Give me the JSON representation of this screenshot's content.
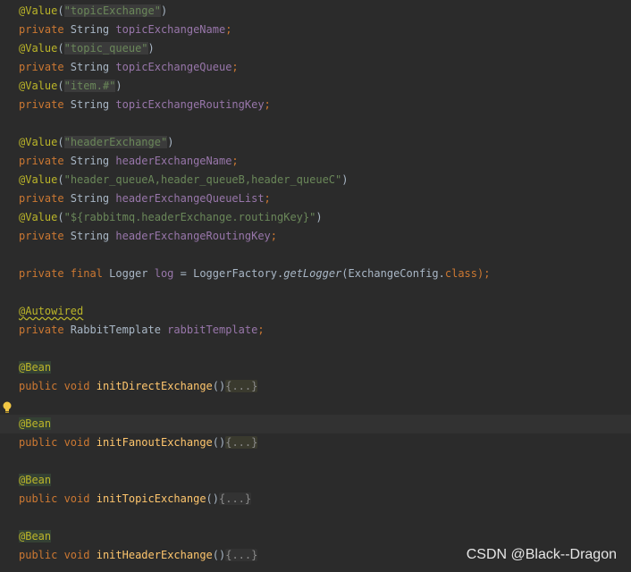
{
  "editor": {
    "lines": {
      "l1": {
        "ann": "@Value",
        "p1": "(",
        "str": "\"topicExchange\"",
        "p2": ")"
      },
      "l2": {
        "kw": "private",
        "type": " String ",
        "field": "topicExchangeName",
        "end": ";"
      },
      "l3": {
        "ann": "@Value",
        "p1": "(",
        "str": "\"topic_queue\"",
        "p2": ")"
      },
      "l4": {
        "kw": "private",
        "type": " String ",
        "field": "topicExchangeQueue",
        "end": ";"
      },
      "l5": {
        "ann": "@Value",
        "p1": "(",
        "str": "\"item.#\"",
        "p2": ")"
      },
      "l6": {
        "kw": "private",
        "type": " String ",
        "field": "topicExchangeRoutingKey",
        "end": ";"
      },
      "l7": {
        "ann": "@Value",
        "p1": "(",
        "str": "\"headerExchange\"",
        "p2": ")"
      },
      "l8": {
        "kw": "private",
        "type": " String ",
        "field": "headerExchangeName",
        "end": ";"
      },
      "l9": {
        "ann": "@Value",
        "p1": "(",
        "str": "\"header_queueA,header_queueB,header_queueC\"",
        "p2": ")"
      },
      "l10": {
        "kw": "private",
        "type": " String ",
        "field": "headerExchangeQueueList",
        "end": ";"
      },
      "l11": {
        "ann": "@Value",
        "p1": "(",
        "str": "\"${rabbitmq.headerExchange.routingKey}\"",
        "p2": ")"
      },
      "l12": {
        "kw": "private",
        "type": " String ",
        "field": "headerExchangeRoutingKey",
        "end": ";"
      },
      "l13": {
        "kw1": "private",
        "kw2": " final",
        "type": " Logger ",
        "field": "log",
        "eq": " = LoggerFactory.",
        "method": "getLogger",
        "arg": "(ExchangeConfig.",
        "cls": "class",
        "end": ");"
      },
      "l14": {
        "ann": "@Autowired"
      },
      "l15": {
        "kw": "private",
        "type": " RabbitTemplate ",
        "field": "rabbitTemplate",
        "end": ";"
      },
      "l16": {
        "ann": "@Bean"
      },
      "l17": {
        "kw1": "public",
        "kw2": " void ",
        "fn": "initDirectExchange",
        "paren": "()",
        "fold": "{...}"
      },
      "l18": {
        "ann": "@Bean"
      },
      "l19": {
        "kw1": "public",
        "kw2": " void ",
        "fn": "initFanoutExchange",
        "paren": "()",
        "fold": "{...}"
      },
      "l20": {
        "ann": "@Bean"
      },
      "l21": {
        "kw1": "public",
        "kw2": " void ",
        "fn": "initTopicExchange",
        "paren": "()",
        "fold": "{...}"
      },
      "l22": {
        "ann": "@Bean"
      },
      "l23": {
        "kw1": "public",
        "kw2": " void ",
        "fn": "initHeaderExchange",
        "paren": "()",
        "fold": "{...}"
      }
    },
    "gutter_icon": "lightbulb-icon",
    "colors": {
      "background": "#2b2b2b",
      "current_line": "#323232",
      "annotation": "#bbb529",
      "keyword": "#cc7832",
      "string": "#6a8759",
      "field": "#9876aa",
      "method": "#ffc66d",
      "text": "#a9b7c6"
    }
  },
  "watermark": "CSDN @Black--Dragon"
}
